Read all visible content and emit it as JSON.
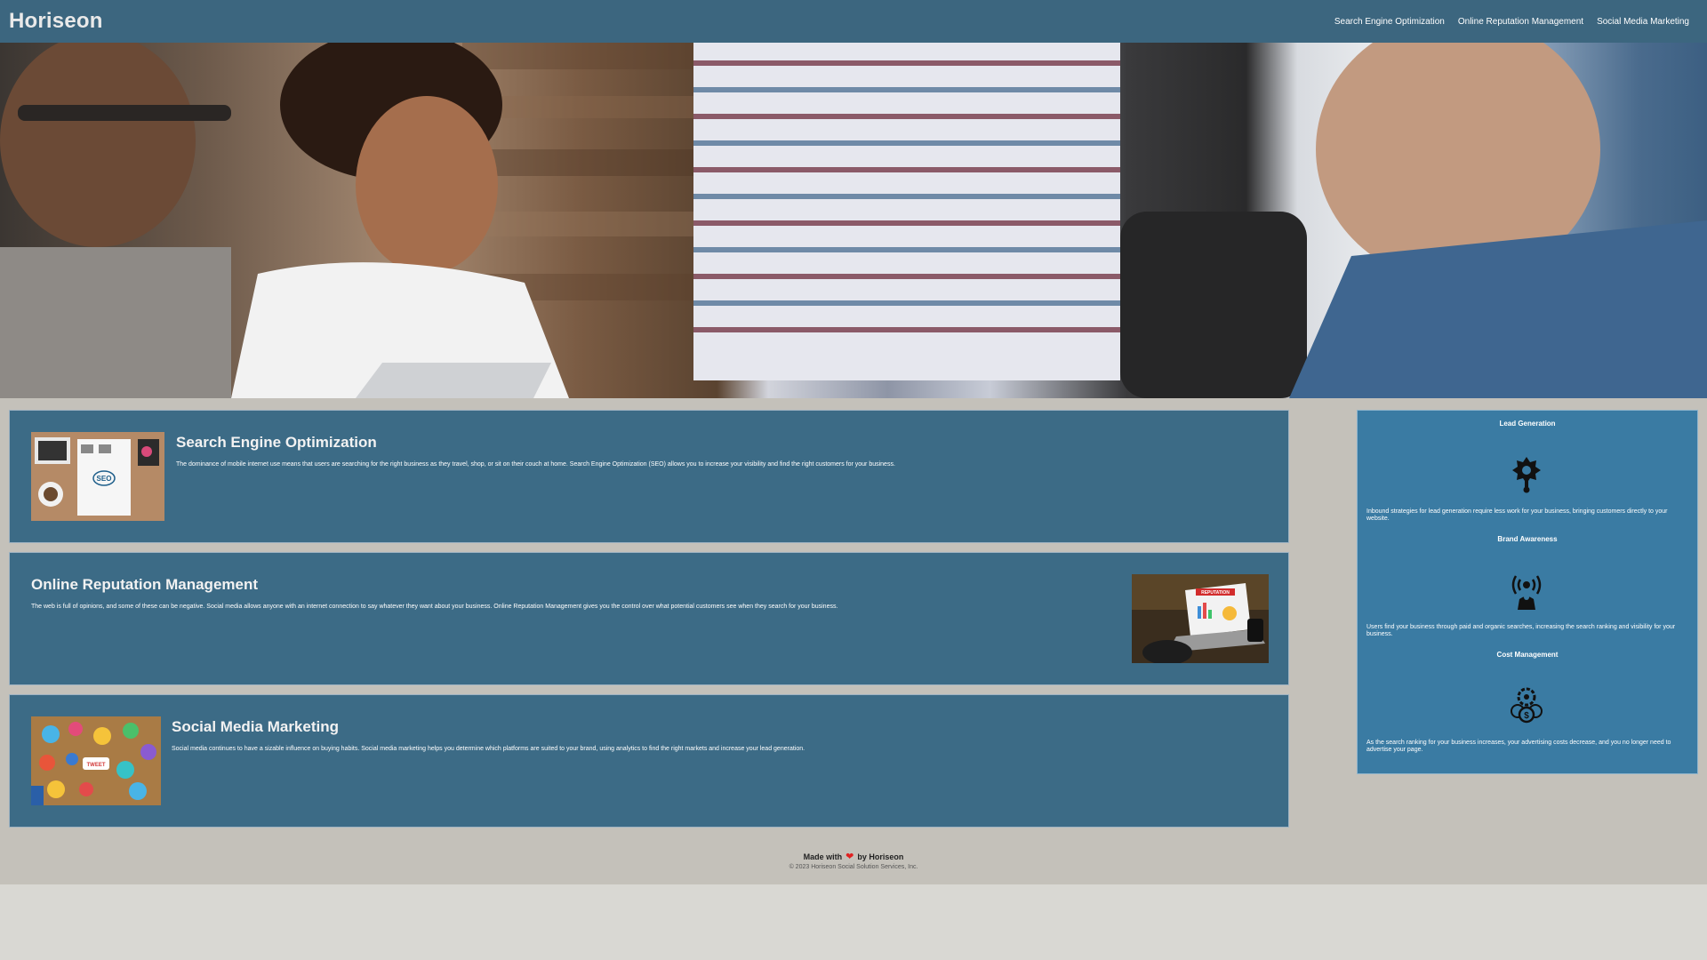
{
  "header": {
    "brand": "Horiseon",
    "nav": [
      "Search Engine Optimization",
      "Online Reputation Management",
      "Social Media Marketing"
    ]
  },
  "hero": {
    "alt": "team meeting photo"
  },
  "cards": [
    {
      "title": "Search Engine Optimization",
      "text": "The dominance of mobile internet use means that users are searching for the right business as they travel, shop, or sit on their couch at home. Search Engine Optimization (SEO) allows you to increase your visibility and find the right customers for your business."
    },
    {
      "title": "Online Reputation Management",
      "text": "The web is full of opinions, and some of these can be negative. Social media allows anyone with an internet connection to say whatever they want about your business. Online Reputation Management gives you the control over what potential customers see when they search for your business."
    },
    {
      "title": "Social Media Marketing",
      "text": "Social media continues to have a sizable influence on buying habits. Social media marketing helps you determine which platforms are suited to your brand, using analytics to find the right markets and increase your lead generation."
    }
  ],
  "thumbs": {
    "seo_badge": "SEO",
    "reputation_label": "REPUTATION",
    "tweet_label": "TWEET"
  },
  "benefits": [
    {
      "title": "Lead Generation",
      "icon": "lead-generation-icon",
      "text": "Inbound strategies for lead generation require less work for your business, bringing customers directly to your website."
    },
    {
      "title": "Brand Awareness",
      "icon": "brand-awareness-icon",
      "text": "Users find your business through paid and organic searches, increasing the search ranking and visibility for your business."
    },
    {
      "title": "Cost Management",
      "icon": "cost-management-icon",
      "text": "As the search ranking for your business increases, your advertising costs decrease, and you no longer need to advertise your page."
    }
  ],
  "footer": {
    "made_prefix": "Made with",
    "heart": "❤",
    "made_suffix": "by Horiseon",
    "copyright": "© 2023 Horiseon Social Solution Services, Inc."
  },
  "colors": {
    "header": "#3c667f",
    "card": "#3c6b86",
    "aside": "#3a7ba3",
    "page": "#c4c1ba"
  }
}
